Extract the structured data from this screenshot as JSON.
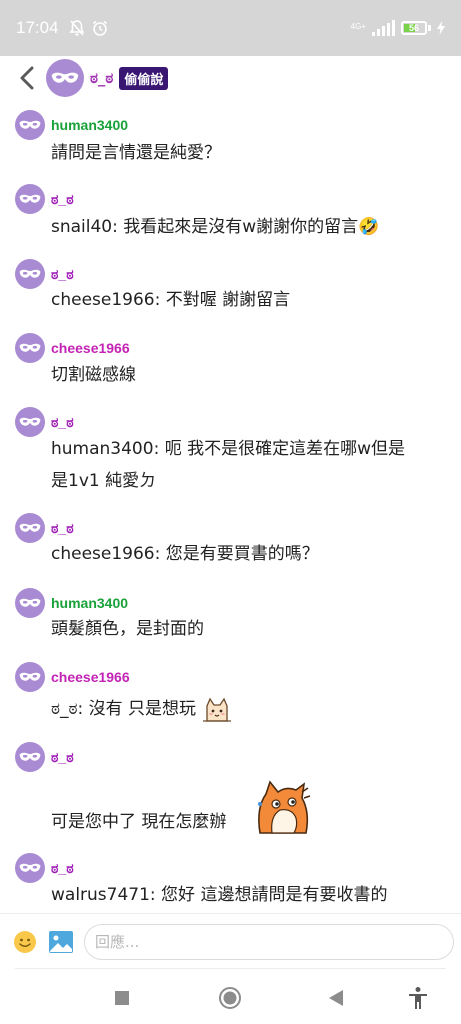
{
  "status_bar": {
    "time": "17:04",
    "network": "4G+",
    "battery": "56",
    "battery_level": 0.56
  },
  "header": {
    "name": "ಠ_ಠ",
    "badge": "偷偷說"
  },
  "messages": [
    {
      "author": "human3400",
      "lines": [
        "請問是言情還是純愛？"
      ]
    },
    {
      "author": "ಠ_ಠ",
      "lines": [
        "snail40: 我看起來是沒有w謝謝你的留言🤣"
      ]
    },
    {
      "author": "ಠ_ಠ",
      "lines": [
        "cheese1966: 不對喔 謝謝留言"
      ]
    },
    {
      "author": "cheese1966",
      "lines": [
        "切割磁感線"
      ]
    },
    {
      "author": "ಠ_ಠ",
      "lines": [
        "human3400: 呃 我不是很確定這差在哪w但是",
        "是1v1 純愛ㄉ"
      ]
    },
    {
      "author": "ಠ_ಠ",
      "lines": [
        "cheese1966: 您是有要買書的嗎？"
      ]
    },
    {
      "author": "human3400",
      "lines": [
        "頭髮顏色，是封面的"
      ]
    },
    {
      "author": "cheese1966",
      "lines": [
        "ಠ_ಠ: 沒有 只是想玩"
      ]
    },
    {
      "author": "ಠ_ಠ",
      "lines": [
        "可是您中了 現在怎麼辦"
      ]
    },
    {
      "author": "ಠ_ಠ",
      "lines": [
        "walrus7471: 您好 這邊想請問是有要收書的"
      ]
    }
  ],
  "composer": {
    "placeholder": "回應..."
  },
  "colors": {
    "avatar": "#a98bd3",
    "author_green": "#1aa23a",
    "author_purple": "#a020b8",
    "badge_bg": "#3a1673",
    "status_bar_bg": "#d6d6d6"
  },
  "icons": {
    "back": "chevron-left-icon",
    "avatar": "mask-avatar-icon",
    "emoji": "smiley-icon",
    "image": "image-icon",
    "nav_recents": "square-icon",
    "nav_home": "circle-icon",
    "nav_back": "triangle-left-icon",
    "nav_accessibility": "accessibility-icon"
  }
}
